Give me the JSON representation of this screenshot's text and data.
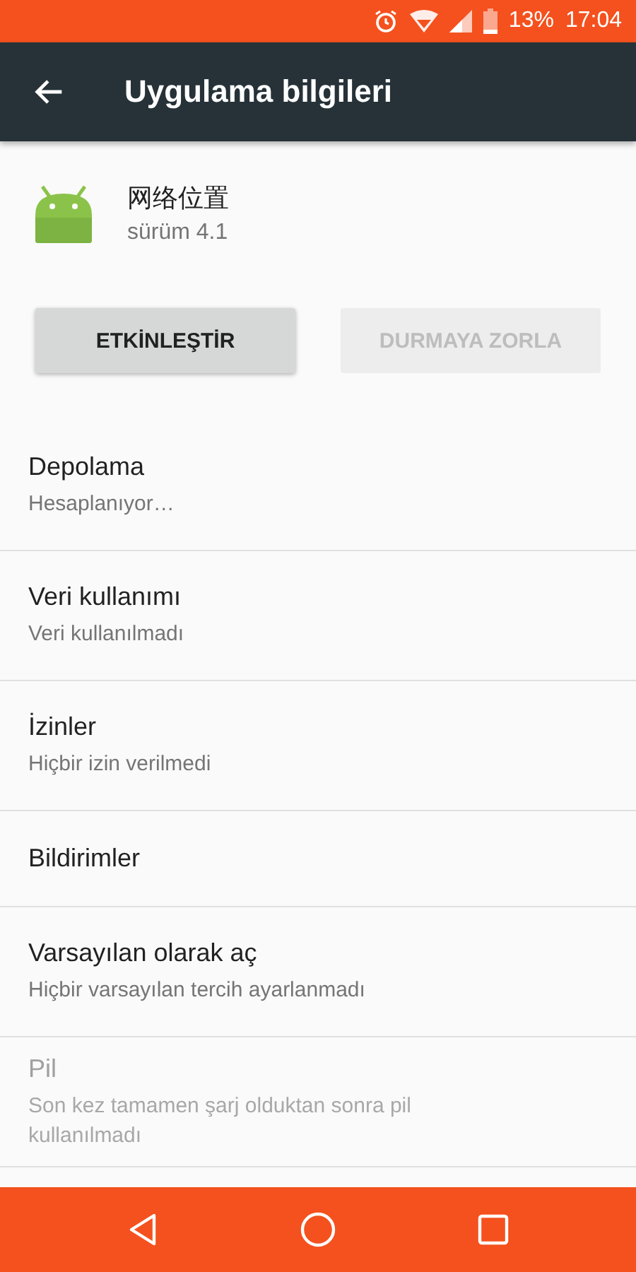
{
  "status_bar": {
    "battery": "13%",
    "time": "17:04"
  },
  "app_bar": {
    "title": "Uygulama bilgileri"
  },
  "app": {
    "name": "网络位置",
    "version": "sürüm 4.1"
  },
  "buttons": [
    {
      "label": "ETKİNLEŞTİR",
      "disabled": false
    },
    {
      "label": "DURMAYA ZORLA",
      "disabled": true
    }
  ],
  "items": [
    {
      "title": "Depolama",
      "subtitle": "Hesaplanıyor…",
      "disabled": false
    },
    {
      "title": "Veri kullanımı",
      "subtitle": "Veri kullanılmadı",
      "disabled": false
    },
    {
      "title": "İzinler",
      "subtitle": "Hiçbir izin verilmedi",
      "disabled": false
    },
    {
      "title": "Bildirimler",
      "disabled": false
    },
    {
      "title": "Varsayılan olarak aç",
      "subtitle": "Hiçbir varsayılan tercih ayarlanmadı",
      "disabled": false
    },
    {
      "title": "Pil",
      "subtitle": "Son kez tamamen şarj olduktan sonra pil kullanılmadı",
      "disabled": true
    }
  ]
}
